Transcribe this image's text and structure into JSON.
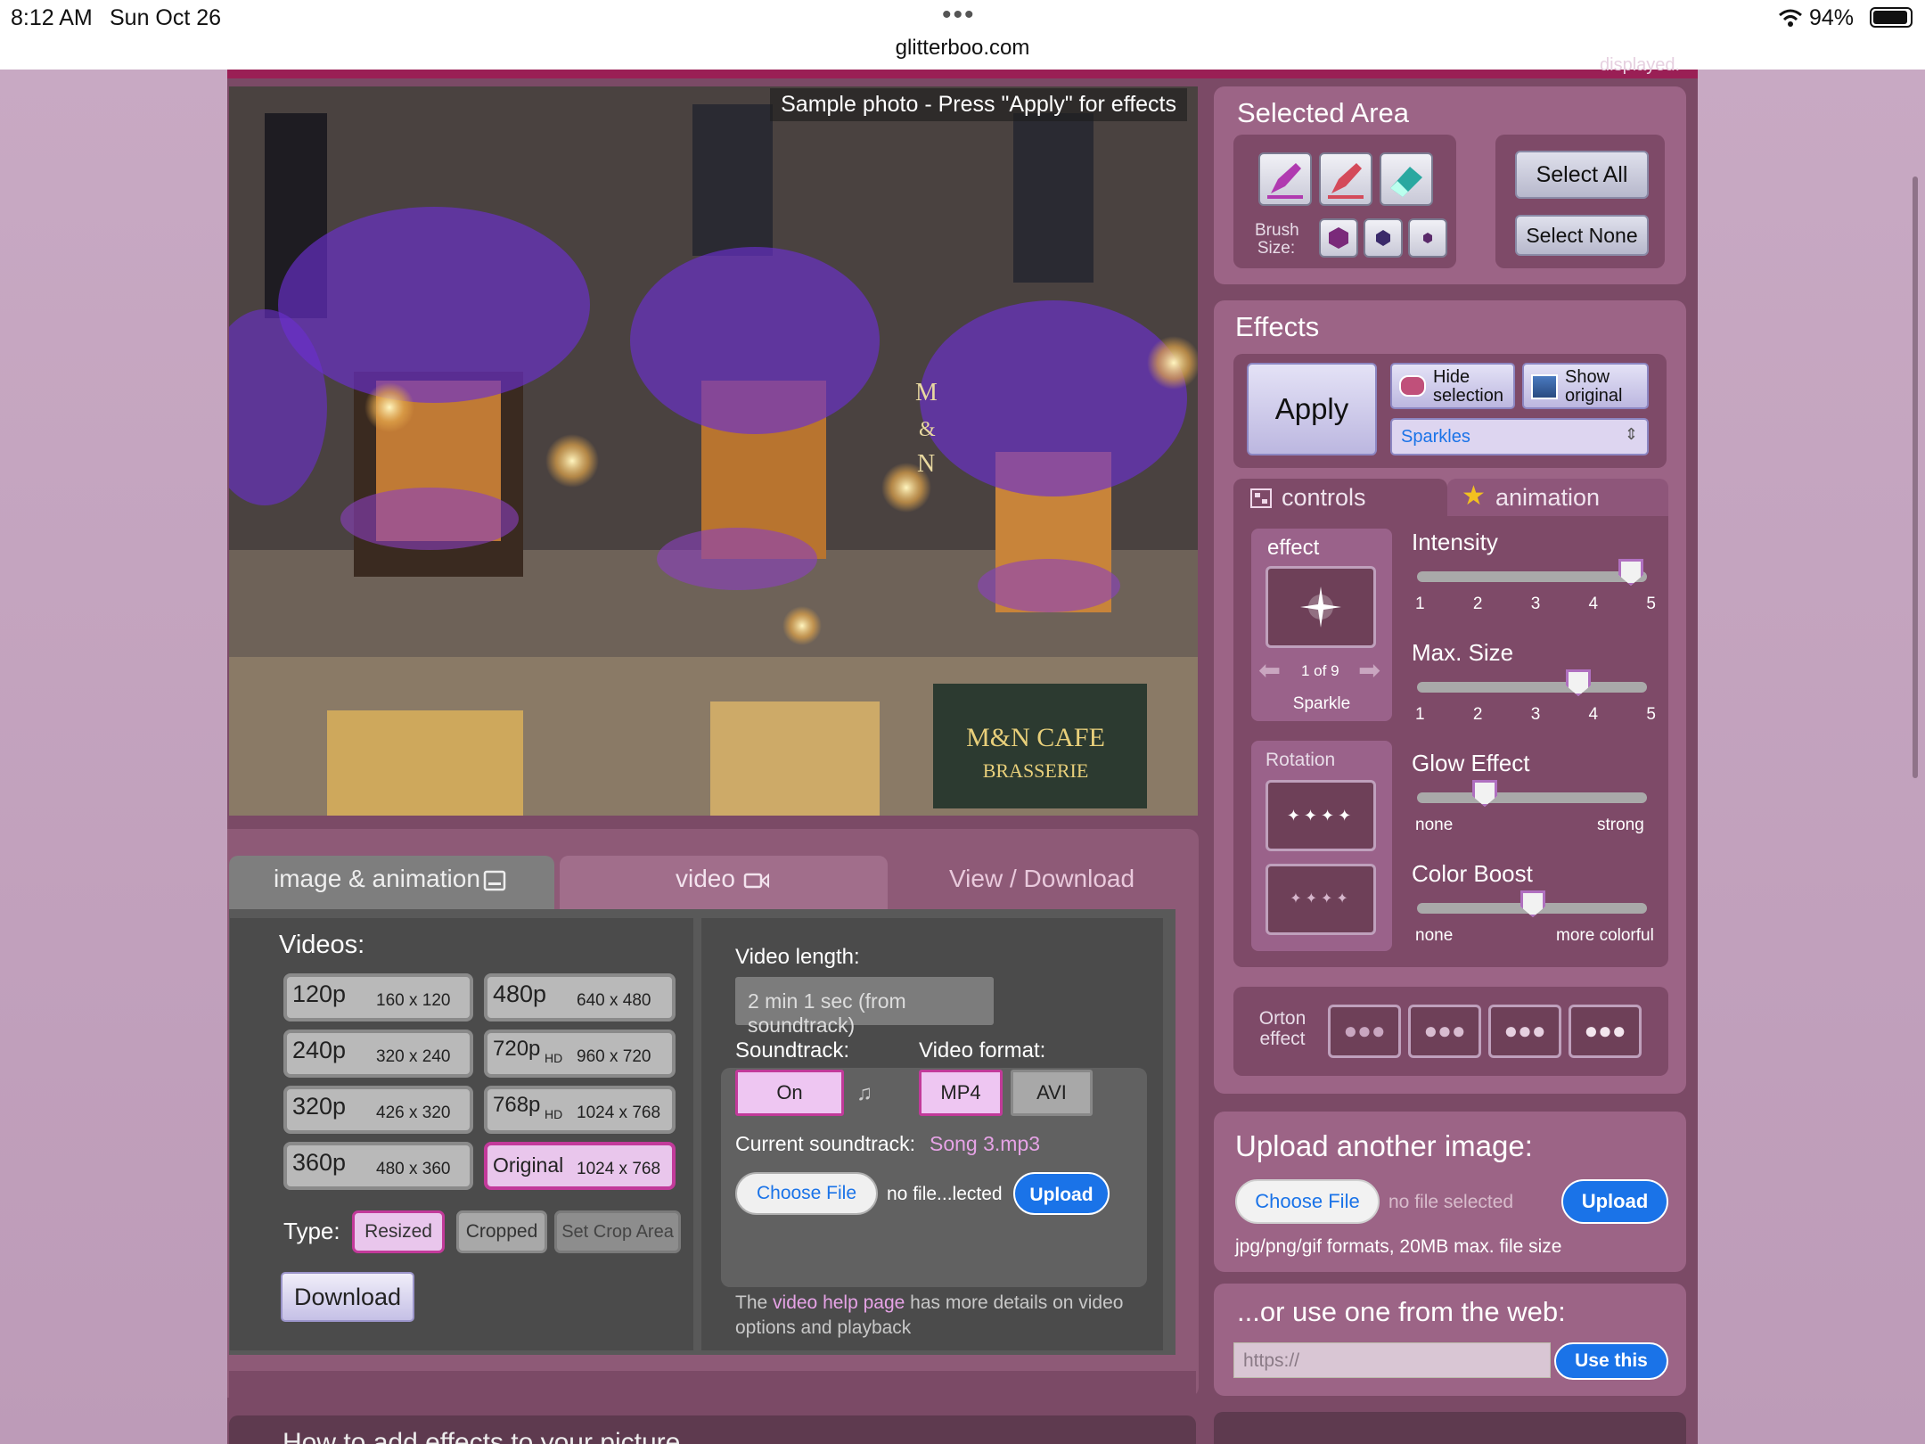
{
  "status": {
    "time": "8:12 AM",
    "date": "Sun Oct 26",
    "url": "glitterboo.com",
    "battery": "94%"
  },
  "photo": {
    "caption": "Sample photo - Press \"Apply\" for effects",
    "top_cut": "displayed."
  },
  "tabs": {
    "image": "image & animation",
    "video": "video",
    "view": "View / Download"
  },
  "videos": {
    "title": "Videos:",
    "resolutions": [
      {
        "label": "120p",
        "hd": "",
        "size": "160 x 120"
      },
      {
        "label": "480p",
        "hd": "",
        "size": "640 x 480"
      },
      {
        "label": "240p",
        "hd": "",
        "size": "320 x 240"
      },
      {
        "label": "720p",
        "hd": "HD",
        "size": "960 x 720"
      },
      {
        "label": "320p",
        "hd": "",
        "size": "426 x 320"
      },
      {
        "label": "768p",
        "hd": "HD",
        "size": "1024 x 768"
      },
      {
        "label": "360p",
        "hd": "",
        "size": "480 x 360"
      },
      {
        "label": "Original",
        "hd": "",
        "size": "1024 x 768"
      }
    ],
    "type_label": "Type:",
    "types": [
      "Resized",
      "Cropped",
      "Set Crop Area"
    ],
    "download": "Download"
  },
  "video_opts": {
    "length_label": "Video length:",
    "length_value": "2 min 1 sec (from soundtrack)",
    "soundtrack_label": "Soundtrack:",
    "soundtrack_on": "On",
    "format_label": "Video format:",
    "formats": [
      "MP4",
      "AVI"
    ],
    "current_label": "Current soundtrack:",
    "current_value": "Song 3.mp3",
    "choose": "Choose File",
    "no_file": "no file...lected",
    "upload": "Upload",
    "help_pre": "The ",
    "help_link": "video help page",
    "help_post": " has more details on video options and playback"
  },
  "selected": {
    "title": "Selected Area",
    "brush_label": "Brush Size:",
    "select_all": "Select All",
    "select_none": "Select None"
  },
  "effects": {
    "title": "Effects",
    "apply": "Apply",
    "hide": "Hide selection",
    "show": "Show original",
    "dropdown": "Sparkles",
    "tab_controls": "controls",
    "tab_animation": "animation",
    "effect_label": "effect",
    "counter": "1 of 9",
    "effect_name": "Sparkle",
    "rotation": "Rotation",
    "sliders": [
      {
        "name": "Intensity",
        "value": 5,
        "ticks": [
          "1",
          "2",
          "3",
          "4",
          "5"
        ]
      },
      {
        "name": "Max. Size",
        "value": 4,
        "ticks": [
          "1",
          "2",
          "3",
          "4",
          "5"
        ]
      },
      {
        "name": "Glow Effect",
        "value": 0.25,
        "ends": [
          "none",
          "strong"
        ]
      },
      {
        "name": "Color Boost",
        "value": 0.5,
        "ends": [
          "none",
          "more colorful"
        ]
      }
    ],
    "orton": "Orton effect"
  },
  "upload": {
    "title": "Upload another image:",
    "choose": "Choose File",
    "no_file": "no file selected",
    "button": "Upload",
    "note": "jpg/png/gif formats,  20MB max. file size"
  },
  "web": {
    "title": "...or use one from the web:",
    "placeholder": "https://",
    "button": "Use this"
  },
  "bottom": {
    "heading": "How to add effects to your picture"
  }
}
